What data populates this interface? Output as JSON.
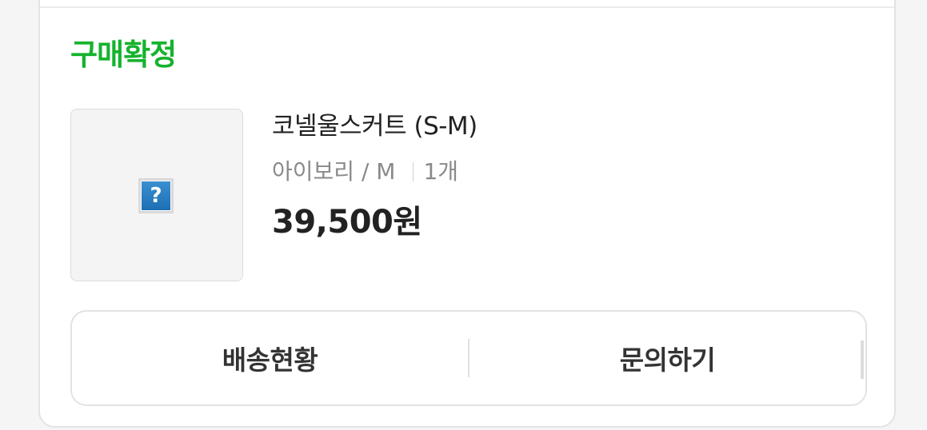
{
  "order": {
    "status_label": "구매확정",
    "status_color": "#14b32d",
    "thumbnail_icon": "broken-image-icon",
    "thumbnail_glyph": "?",
    "product_name": "코넬울스커트 (S-M)",
    "option_text": "아이보리 / M",
    "quantity_text": "1개",
    "price_text": "39,500원"
  },
  "actions": {
    "track_delivery_label": "배송현황",
    "inquiry_label": "문의하기"
  }
}
